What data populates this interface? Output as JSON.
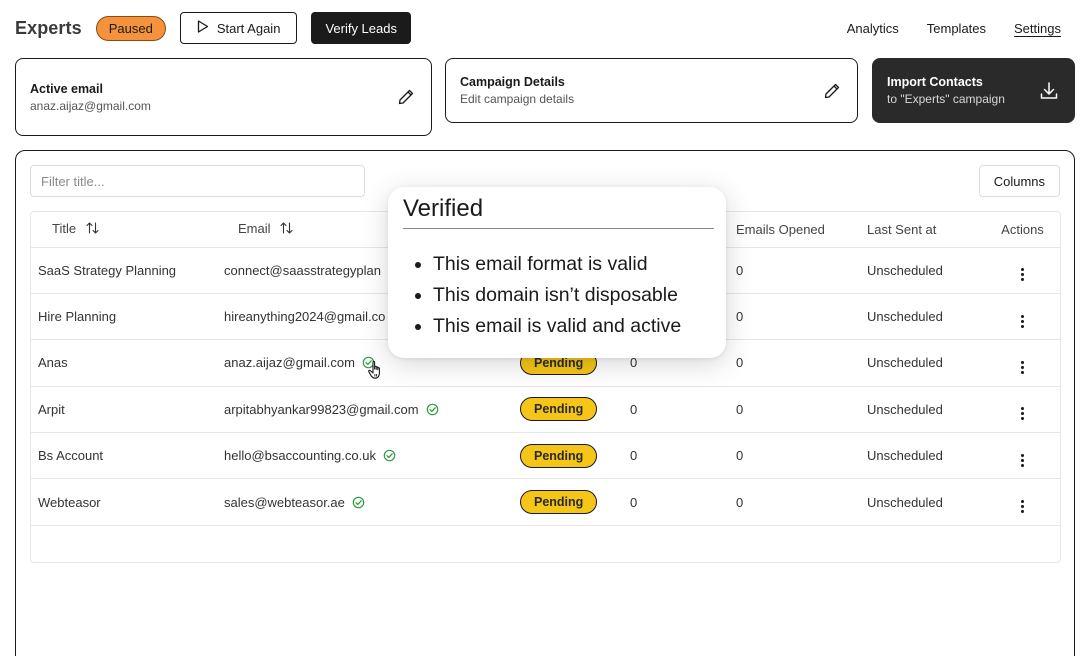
{
  "header": {
    "title": "Experts",
    "status_badge": "Paused",
    "start_again_label": "Start Again",
    "verify_leads_label": "Verify Leads",
    "nav": [
      {
        "label": "Analytics"
      },
      {
        "label": "Templates"
      },
      {
        "label": "Settings",
        "active": true
      }
    ]
  },
  "cards": {
    "active_email": {
      "title": "Active email",
      "value": "anaz.aijaz@gmail.com",
      "icon": "pencil-icon"
    },
    "campaign": {
      "title": "Campaign Details",
      "subtitle": "Edit campaign details",
      "icon": "pencil-icon"
    },
    "import": {
      "title": "Import Contacts",
      "subtitle": "to \"Experts\" campaign",
      "icon": "download-icon"
    }
  },
  "table": {
    "filter_placeholder": "Filter title...",
    "columns_button": "Columns",
    "headers": {
      "title": "Title",
      "email": "Email",
      "status": "",
      "sent": "",
      "opened": "Emails Opened",
      "last_sent": "Last Sent at",
      "actions": "Actions"
    },
    "rows": [
      {
        "title": "SaaS Strategy Planning",
        "email": "connect@saasstrategyplan",
        "status": "",
        "sent": "",
        "opened": "0",
        "last_sent": "Unscheduled"
      },
      {
        "title": "Hire Planning",
        "email": "hireanything2024@gmail.co",
        "status": "",
        "sent": "",
        "opened": "0",
        "last_sent": "Unscheduled"
      },
      {
        "title": "Anas",
        "email": "anaz.aijaz@gmail.com",
        "status": "Pending",
        "sent": "0",
        "opened": "0",
        "last_sent": "Unscheduled"
      },
      {
        "title": "Arpit",
        "email": "arpitabhyankar99823@gmail.com",
        "status": "Pending",
        "sent": "0",
        "opened": "0",
        "last_sent": "Unscheduled"
      },
      {
        "title": "Bs Account",
        "email": "hello@bsaccounting.co.uk",
        "status": "Pending",
        "sent": "0",
        "opened": "0",
        "last_sent": "Unscheduled"
      },
      {
        "title": "Webteasor",
        "email": "sales@webteasor.ae",
        "status": "Pending",
        "sent": "0",
        "opened": "0",
        "last_sent": "Unscheduled"
      }
    ]
  },
  "tooltip": {
    "title": "Verified",
    "items": [
      "This email format is valid",
      "This domain isn’t disposable",
      "This email is valid and active"
    ]
  },
  "colors": {
    "paused": "#f5923e",
    "pending": "#f5c518",
    "verified_check": "#2e9d3f",
    "dark": "#1b1b1b"
  }
}
